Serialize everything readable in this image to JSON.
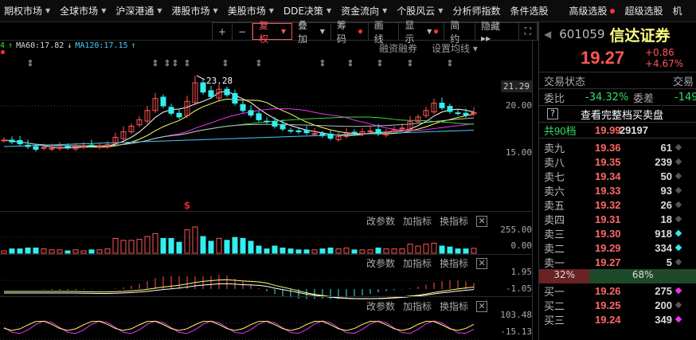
{
  "menubar": {
    "items": [
      {
        "label": "期权市场",
        "caret": true
      },
      {
        "label": "全球市场",
        "caret": true
      },
      {
        "label": "沪深港通",
        "caret": true
      },
      {
        "label": "港股市场",
        "caret": true
      },
      {
        "label": "美股市场",
        "caret": true
      },
      {
        "label": "DDE决策",
        "caret": true
      },
      {
        "label": "资金流向",
        "caret": true
      },
      {
        "label": "个股风云",
        "caret": true
      },
      {
        "label": "分析师指数",
        "caret": false
      },
      {
        "label": "条件选股",
        "caret": false
      },
      {
        "label": "高级选股",
        "caret": false,
        "dot": true
      },
      {
        "label": "超级选股",
        "caret": false
      },
      {
        "label": "机",
        "caret": false
      }
    ]
  },
  "toolbar": {
    "plus": "+",
    "minus": "−",
    "fuquan": "复权",
    "diejia": "叠加",
    "chouma": "筹码",
    "huaxian": "画线",
    "xianshi": "显示",
    "jianyue": "简约",
    "yincang": "隐藏 ▸▸",
    "fullscreen": "⛶"
  },
  "ma_legend": {
    "prev_tail": "4",
    "prev_arrow": "↑",
    "ma60": "MA60:17.82",
    "ma60_arrow": "↓",
    "ma120": "MA120:17.15",
    "ma120_arrow": "↑"
  },
  "chart_links": {
    "margin": "融资融券",
    "set_ma": "设置均线 ▾"
  },
  "chart_data": {
    "type": "candlestick",
    "closes": [
      16.3,
      16.1,
      15.9,
      15.6,
      15.3,
      15.5,
      15.4,
      15.5,
      15.5,
      15.6,
      15.6,
      15.7,
      15.6,
      15.8,
      16.6,
      17.2,
      17.8,
      18.5,
      19.5,
      20.8,
      20.0,
      19.2,
      18.8,
      20.5,
      22.5,
      21.5,
      21.0,
      21.8,
      21.2,
      20.3,
      19.5,
      19.0,
      18.5,
      18.3,
      17.8,
      17.5,
      17.3,
      17.2,
      17.1,
      17.0,
      16.8,
      16.5,
      16.7,
      17.0,
      17.1,
      17.2,
      17.3,
      17.0,
      17.2,
      17.4,
      17.6,
      18.3,
      18.8,
      19.5,
      20.3,
      19.8,
      19.4,
      19.2,
      19.0,
      19.27
    ],
    "max_label": "23.28",
    "main_axis": [
      "21.29",
      "20.00",
      "15.00"
    ],
    "vol_axis": [
      "255.00",
      "0.00"
    ],
    "macd_axis": [
      "1.95",
      "-1.05"
    ],
    "kdj_axis": [
      "103.48",
      "-15.13"
    ],
    "event_marker": "$"
  },
  "panel_header": {
    "change_params": "改参数",
    "add_indicator": "加指标",
    "swap_indicator": "换指标",
    "close": "✕"
  },
  "right_panel": {
    "code": "601059",
    "name": "信达证券",
    "price": "19.27",
    "change": "+0.86",
    "change_pct": "+4.67%",
    "status_label": "交易状态",
    "status_value": "交易",
    "weibi_label": "委比",
    "weibi": "-34.32%",
    "weicha_label": "委差",
    "weicha": "-149",
    "help": "?",
    "full_book": "查看完整档买卖盘",
    "total_label": "共90档",
    "total_price": "19.99",
    "total_vol": "29197",
    "asks": [
      {
        "label": "卖九",
        "price": "19.36",
        "vol": "61",
        "dot": "#555"
      },
      {
        "label": "卖八",
        "price": "19.35",
        "vol": "239",
        "dot": "#555"
      },
      {
        "label": "卖七",
        "price": "19.34",
        "vol": "50",
        "dot": "#555"
      },
      {
        "label": "卖六",
        "price": "19.33",
        "vol": "93",
        "dot": "#555"
      },
      {
        "label": "卖五",
        "price": "19.32",
        "vol": "26",
        "dot": "#555"
      },
      {
        "label": "卖四",
        "price": "19.31",
        "vol": "18",
        "dot": "#555"
      },
      {
        "label": "卖三",
        "price": "19.30",
        "vol": "918",
        "dot": "#3ee"
      },
      {
        "label": "卖二",
        "price": "19.29",
        "vol": "334",
        "dot": "#3ee"
      },
      {
        "label": "卖一",
        "price": "19.27",
        "vol": "5",
        "dot": "#555"
      }
    ],
    "ratio_buy": "32%",
    "ratio_sell": "68%",
    "ratio_buy_value": 32,
    "bids": [
      {
        "label": "买一",
        "price": "19.26",
        "vol": "275",
        "dot": "#e3e"
      },
      {
        "label": "买二",
        "price": "19.25",
        "vol": "200",
        "dot": "#555"
      },
      {
        "label": "买三",
        "price": "19.24",
        "vol": "349",
        "dot": "#e3e"
      }
    ]
  }
}
